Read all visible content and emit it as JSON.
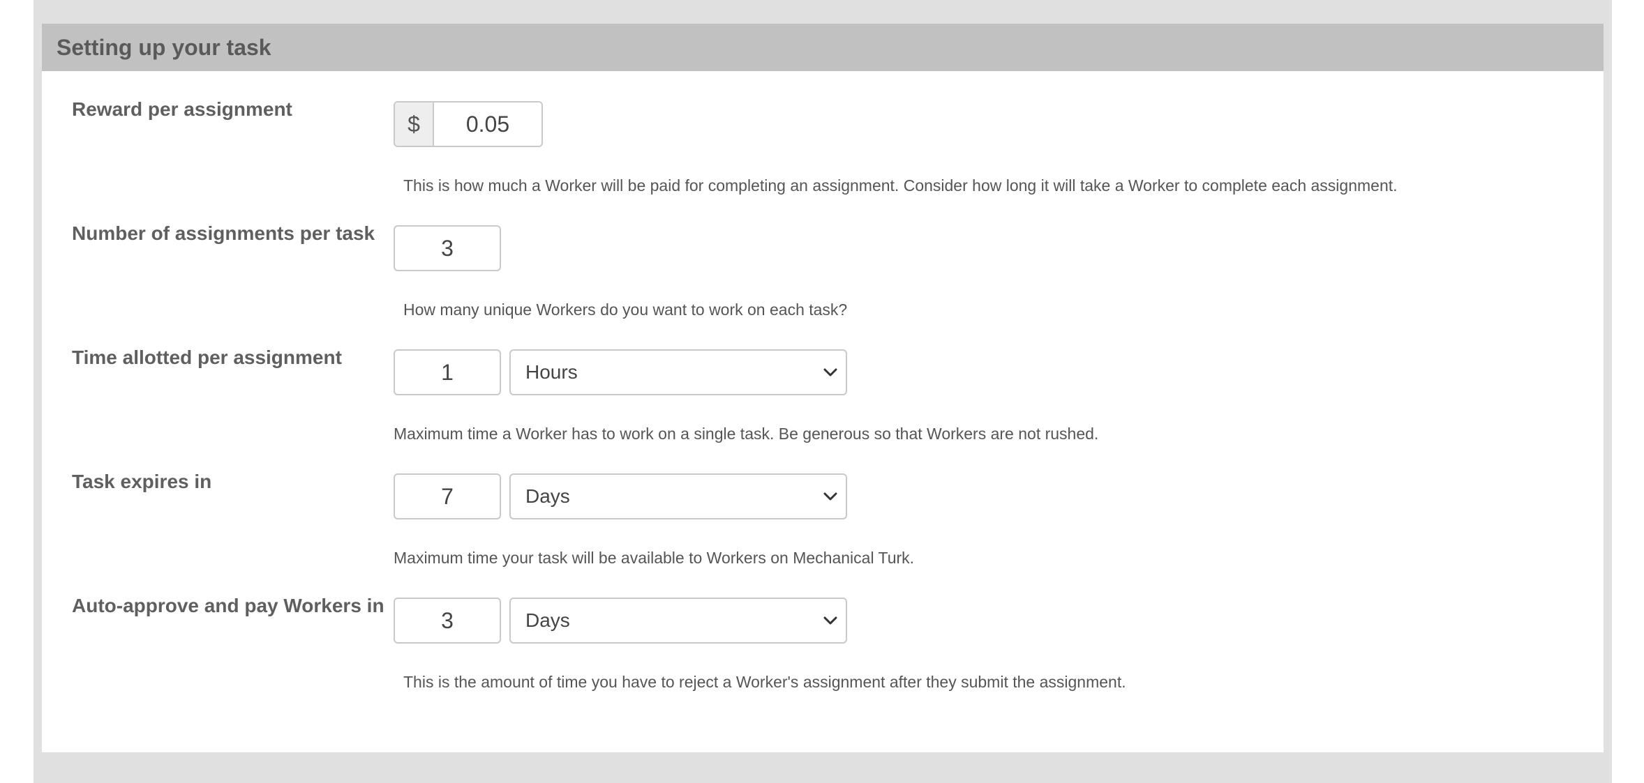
{
  "section": {
    "title": "Setting up your task"
  },
  "reward": {
    "label": "Reward per assignment",
    "currency_symbol": "$",
    "value": "0.05",
    "help": "This is how much a Worker will be paid for completing an assignment. Consider how long it will take a Worker to complete each assignment."
  },
  "assignments": {
    "label": "Number of assignments per task",
    "value": "3",
    "help": "How many unique Workers do you want to work on each task?"
  },
  "time_allotted": {
    "label": "Time allotted per assignment",
    "value": "1",
    "unit": "Hours",
    "help": "Maximum time a Worker has to work on a single task. Be generous so that Workers are not rushed."
  },
  "expires": {
    "label": "Task expires in",
    "value": "7",
    "unit": "Days",
    "help": "Maximum time your task will be available to Workers on Mechanical Turk."
  },
  "auto_approve": {
    "label": "Auto-approve and pay Workers in",
    "value": "3",
    "unit": "Days",
    "help": "This is the amount of time you have to reject a Worker's assignment after they submit the assignment."
  },
  "icons": {
    "select_arrow": "chevron-down-icon"
  },
  "colors": {
    "header_bg": "#c1c1c1",
    "outer_bg": "#e0e0e0",
    "label_text": "#5f5f5f",
    "input_border": "#c9c9c9"
  }
}
